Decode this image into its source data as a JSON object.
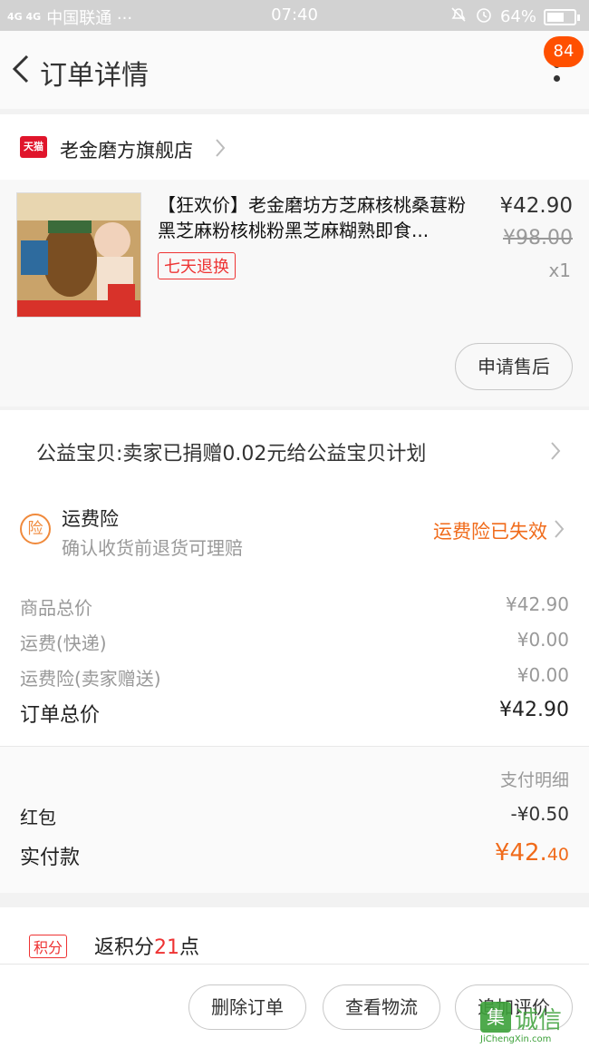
{
  "status_bar": {
    "network": "4G 4G",
    "carrier": "中国联通 ···",
    "time": "07:40",
    "battery_text": "64%",
    "battery_level": 0.64
  },
  "header": {
    "title": "订单详情",
    "badge_count": "84"
  },
  "shop": {
    "tmall_label": "天猫",
    "name": "老金磨方旗舰店"
  },
  "product": {
    "title": "【狂欢价】老金磨坊方芝麻核桃桑葚粉黑芝麻粉核桃粉黑芝麻糊熟即食...",
    "tag": "七天退换",
    "price": "¥42.90",
    "original_price": "¥98.00",
    "quantity": "x1",
    "after_sale_label": "申请售后"
  },
  "charity": {
    "text": "公益宝贝:卖家已捐赠0.02元给公益宝贝计划"
  },
  "insurance": {
    "icon_text": "险",
    "title": "运费险",
    "subtitle": "确认收货前退货可理赔",
    "status": "运费险已失效"
  },
  "totals": {
    "goods_label": "商品总价",
    "goods_value": "¥42.90",
    "shipping_label": "运费(快递)",
    "shipping_value": "¥0.00",
    "ins_label": "运费险(卖家赠送)",
    "ins_value": "¥0.00",
    "total_label": "订单总价",
    "total_value": "¥42.90"
  },
  "payment": {
    "detail_label": "支付明细",
    "redpacket_label": "红包",
    "redpacket_value": "-¥0.50",
    "paid_label": "实付款",
    "paid_main": "¥42.",
    "paid_decimal": "40"
  },
  "points": {
    "tag": "积分",
    "prefix": "返积分",
    "number": "21",
    "suffix": "点"
  },
  "bottom_bar": {
    "delete": "删除订单",
    "logistics": "查看物流",
    "review": "追加评价"
  },
  "watermark": {
    "logo": "集",
    "text": "诚信",
    "url": "JiChengXin.com"
  },
  "colors": {
    "accent": "#ff5000",
    "orange_text": "#f06b1b",
    "red": "#e33333",
    "tmall": "#e0152b"
  }
}
